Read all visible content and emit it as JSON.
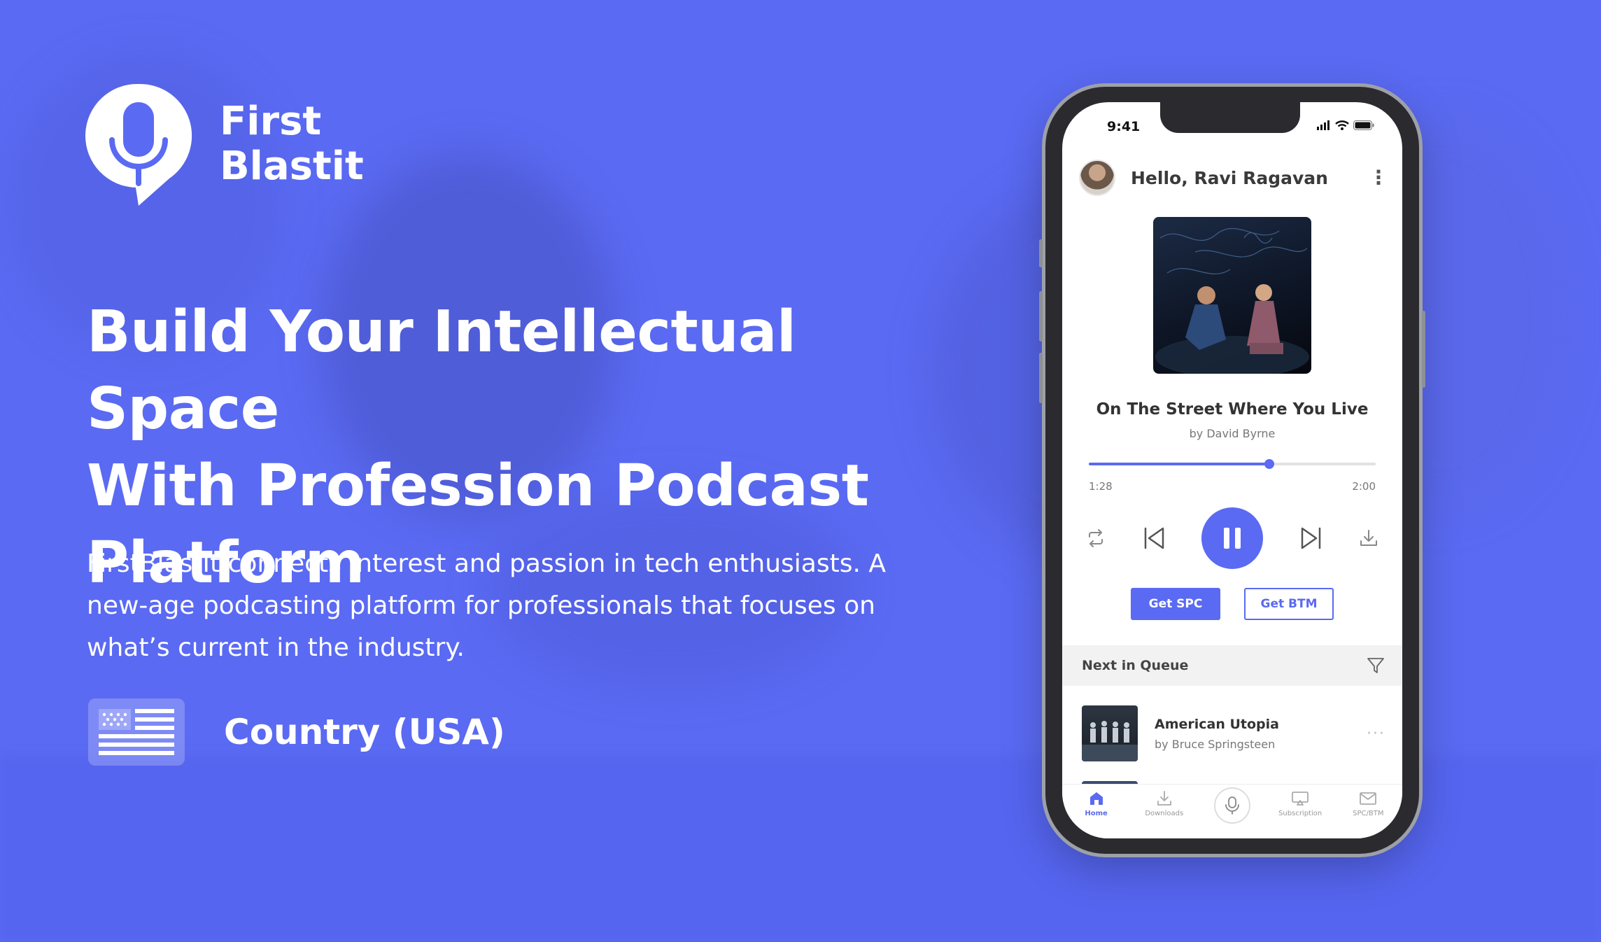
{
  "brand": {
    "name_line1": "First",
    "name_line2": "Blastit",
    "accent_color": "#5a6af2"
  },
  "hero": {
    "headline_line1": "Build Your Intellectual Space",
    "headline_line2": "With Profession Podcast",
    "headline_line3": "Platform",
    "description": "FirstBlastIt connects interest and passion in tech enthusiasts. A new-age podcasting platform for professionals that focuses on what’s current in the industry.",
    "country_label": "Country (USA)",
    "country_icon": "usa-flag-icon"
  },
  "phone": {
    "status_time": "9:41",
    "greeting": "Hello, Ravi Ragavan",
    "now_playing": {
      "title": "On The Street Where You Live",
      "artist": "by David Byrne",
      "elapsed": "1:28",
      "duration": "2:00",
      "progress_fraction": 0.63
    },
    "buttons": {
      "primary": "Get SPC",
      "secondary": "Get BTM"
    },
    "queue": {
      "header": "Next in Queue",
      "items": [
        {
          "title": "American Utopia",
          "artist": "by Bruce Springsteen"
        }
      ]
    },
    "tabs": [
      {
        "label": "Home",
        "icon": "home-icon"
      },
      {
        "label": "Downloads",
        "icon": "download-icon"
      },
      {
        "label": "",
        "icon": "microphone-icon"
      },
      {
        "label": "Subscription",
        "icon": "subscription-icon"
      },
      {
        "label": "SPC/BTM",
        "icon": "mail-icon"
      }
    ]
  }
}
